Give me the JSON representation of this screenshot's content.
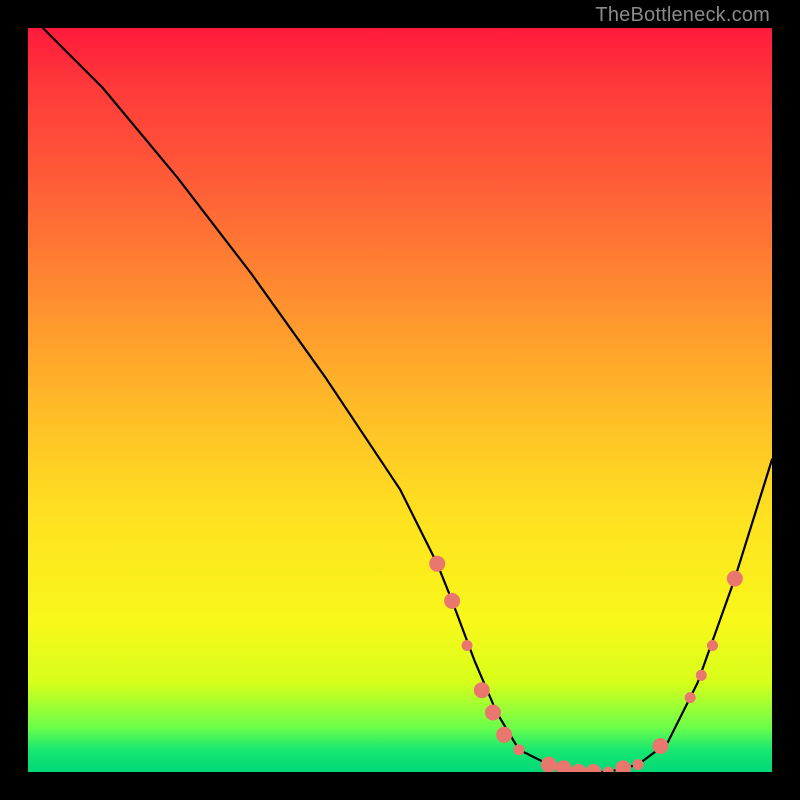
{
  "attribution": "TheBottleneck.com",
  "colors": {
    "background": "#000000",
    "gradient_top": "#ff1a3c",
    "gradient_bottom": "#00d878",
    "curve": "#000000",
    "marker": "#e9776d"
  },
  "chart_data": {
    "type": "line",
    "title": "",
    "xlabel": "",
    "ylabel": "",
    "xlim": [
      0,
      100
    ],
    "ylim": [
      0,
      100
    ],
    "note": "Axes are unlabeled; values are normalized 0–100. y is read as height from the bottom (0 = curve minimum / green band, 100 = top / red).",
    "series": [
      {
        "name": "bottleneck-curve",
        "x": [
          2,
          10,
          20,
          30,
          40,
          50,
          55,
          57,
          60,
          63,
          66,
          70,
          74,
          78,
          82,
          86,
          90,
          95,
          100
        ],
        "y": [
          100,
          92,
          80,
          67,
          53,
          38,
          28,
          23,
          15,
          8,
          3,
          1,
          0,
          0,
          1,
          4,
          12,
          26,
          42
        ]
      }
    ],
    "markers": {
      "note": "Highlighted points along the curve (salmon dots/segments).",
      "points": [
        {
          "x": 55,
          "y": 28,
          "size": "big"
        },
        {
          "x": 57,
          "y": 23,
          "size": "big"
        },
        {
          "x": 59,
          "y": 17,
          "size": "small"
        },
        {
          "x": 61,
          "y": 11,
          "size": "big"
        },
        {
          "x": 62.5,
          "y": 8,
          "size": "big"
        },
        {
          "x": 64,
          "y": 5,
          "size": "big"
        },
        {
          "x": 66,
          "y": 3,
          "size": "small"
        },
        {
          "x": 70,
          "y": 1,
          "size": "big"
        },
        {
          "x": 72,
          "y": 0.5,
          "size": "big"
        },
        {
          "x": 74,
          "y": 0,
          "size": "big"
        },
        {
          "x": 76,
          "y": 0,
          "size": "big"
        },
        {
          "x": 78,
          "y": 0,
          "size": "small"
        },
        {
          "x": 80,
          "y": 0.5,
          "size": "big"
        },
        {
          "x": 82,
          "y": 1,
          "size": "small"
        },
        {
          "x": 85,
          "y": 3.5,
          "size": "big"
        },
        {
          "x": 89,
          "y": 10,
          "size": "small"
        },
        {
          "x": 90.5,
          "y": 13,
          "size": "small"
        },
        {
          "x": 92,
          "y": 17,
          "size": "small"
        },
        {
          "x": 95,
          "y": 26,
          "size": "big"
        }
      ]
    }
  }
}
